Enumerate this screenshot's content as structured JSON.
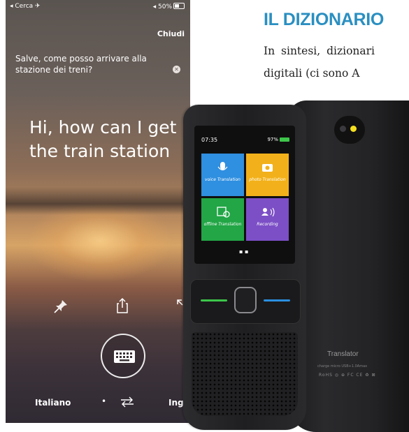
{
  "phone": {
    "status": {
      "carrier": "◂ Cerca ✈",
      "battery": "◂ 50%"
    },
    "close_label": "Chiudi",
    "source_text": "Salve, come posso arrivare alla stazione dei treni?",
    "translated_text_line1": "Hi, how can I get",
    "translated_text_line2": "the train station",
    "lang_from": "Italiano",
    "lang_separator": "•",
    "lang_to": "Ingle"
  },
  "article": {
    "heading": "IL DIZIONARIO",
    "line1": "In sintesi, dizionari",
    "line2": "digitali (ci sono A"
  },
  "device": {
    "screen_time": "07:35",
    "screen_battery": "97%",
    "tiles": [
      {
        "icon": "microphone-icon",
        "label": "voice Translation"
      },
      {
        "icon": "camera-icon",
        "label": "photo Translation"
      },
      {
        "icon": "offline-icon",
        "label": "offline Translation"
      },
      {
        "icon": "recording-icon",
        "label": "Recording"
      }
    ],
    "back_brand": "Translator",
    "back_spec": "charge micro USB+1.0Amax",
    "back_certs": "RoHS ◎ ⊕ FC CE ♻ ⊠",
    "colors": {
      "blue": "#2f8fe0",
      "yellow": "#f2b11a",
      "green": "#22a646",
      "purple": "#7c4fc6",
      "heading": "#2a8fc1"
    }
  }
}
